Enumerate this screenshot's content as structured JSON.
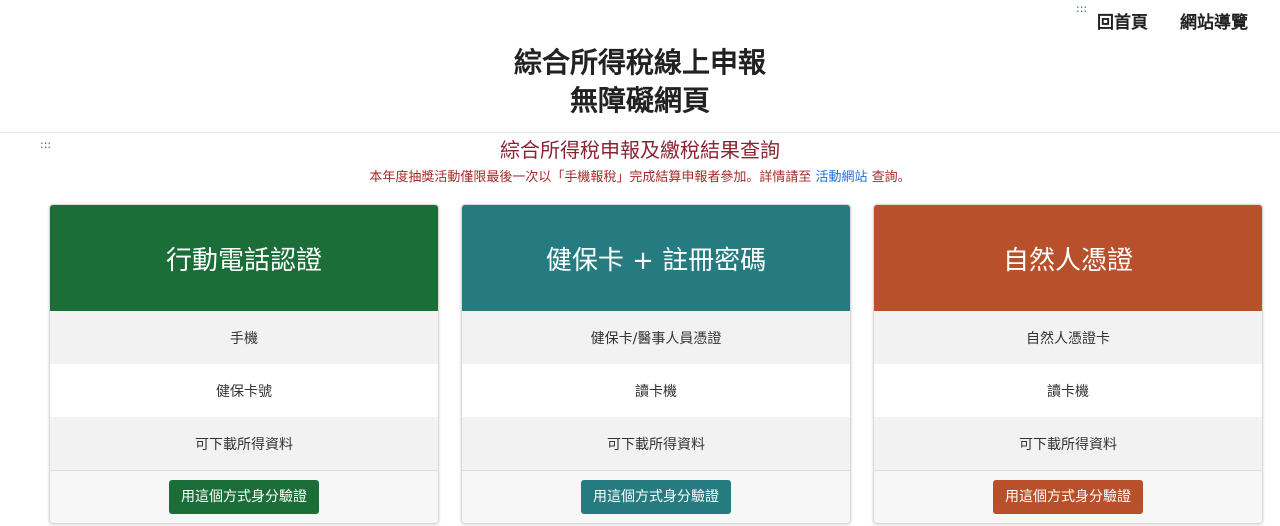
{
  "skip_links": {
    "top": ":::",
    "main": ":::"
  },
  "nav": {
    "home": "回首頁",
    "sitemap": "網站導覽"
  },
  "site_title": {
    "line1": "綜合所得稅線上申報",
    "line2": "無障礙網頁"
  },
  "section_title": "綜合所得稅申報及繳稅結果查詢",
  "notice": {
    "prefix": "本年度抽獎活動僅限最後一次以「手機報稅」完成結算申報者參加。詳情請至",
    "link": "活動網站",
    "suffix": "查詢。"
  },
  "cards": [
    {
      "title": "行動電話認證",
      "items": [
        "手機",
        "健保卡號",
        "可下載所得資料"
      ],
      "button": "用這個方式身分驗證",
      "color": "#1b6e38"
    },
    {
      "title": "健保卡 + 註冊密碼",
      "items": [
        "健保卡/醫事人員憑證",
        "讀卡機",
        "可下載所得資料"
      ],
      "button": "用這個方式身分驗證",
      "color": "#267b80"
    },
    {
      "title": "自然人憑證",
      "items": [
        "自然人憑證卡",
        "讀卡機",
        "可下載所得資料"
      ],
      "button": "用這個方式身分驗證",
      "color": "#b7502b"
    }
  ]
}
